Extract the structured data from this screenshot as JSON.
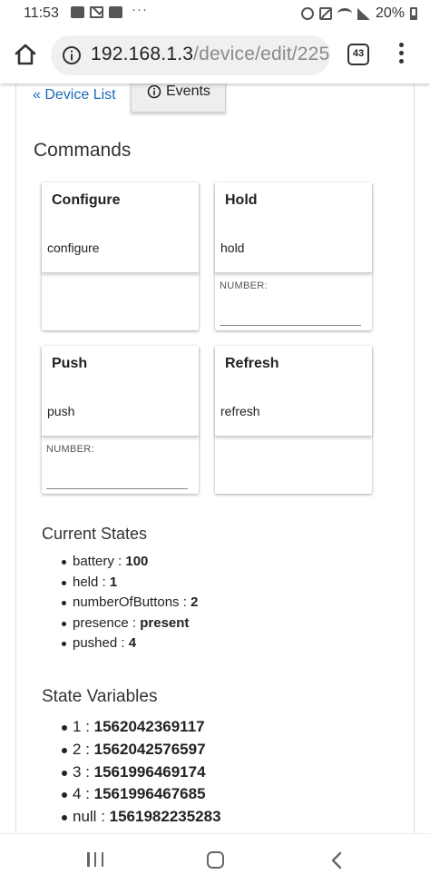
{
  "status_bar": {
    "time": "11:53",
    "left_icons": [
      "gallery-icon",
      "gmail-icon",
      "card-icon"
    ],
    "overflow": "···",
    "right_icons": [
      "alarm-icon",
      "mute-icon",
      "wifi-icon",
      "signal-icon"
    ],
    "battery": "20%"
  },
  "browser": {
    "url_host": "192.168.1.3",
    "url_path": "/device/edit/225",
    "tab_count": "43"
  },
  "page": {
    "device_list_link": "« Device List",
    "events_tab": "Events",
    "commands_title": "Commands",
    "commands": [
      {
        "title": "Configure",
        "command": "configure",
        "param_label": ""
      },
      {
        "title": "Hold",
        "command": "hold",
        "param_label": "NUMBER:"
      },
      {
        "title": "Push",
        "command": "push",
        "param_label": "NUMBER:"
      },
      {
        "title": "Refresh",
        "command": "refresh",
        "param_label": ""
      }
    ],
    "current_states_title": "Current States",
    "current_states": [
      {
        "name": "battery",
        "sep": " : ",
        "value": "100"
      },
      {
        "name": "held",
        "sep": " : ",
        "value": "1"
      },
      {
        "name": "numberOfButtons",
        "sep": " : ",
        "value": "2"
      },
      {
        "name": "presence",
        "sep": " : ",
        "value": "present"
      },
      {
        "name": "pushed",
        "sep": " : ",
        "value": "4"
      }
    ],
    "state_variables_title": "State Variables",
    "state_variables": [
      {
        "name": "1",
        "sep": " : ",
        "value": "1562042369117"
      },
      {
        "name": "2",
        "sep": " : ",
        "value": "1562042576597"
      },
      {
        "name": "3",
        "sep": " : ",
        "value": "1561996469174"
      },
      {
        "name": "4",
        "sep": " : ",
        "value": "1561996467685"
      },
      {
        "name": "null",
        "sep": " : ",
        "value": "1561982235283"
      }
    ]
  },
  "colors": {
    "link": "#1e6bb8",
    "url_path": "#8a8a8a",
    "events_tab_bg": "#eeeeee"
  }
}
